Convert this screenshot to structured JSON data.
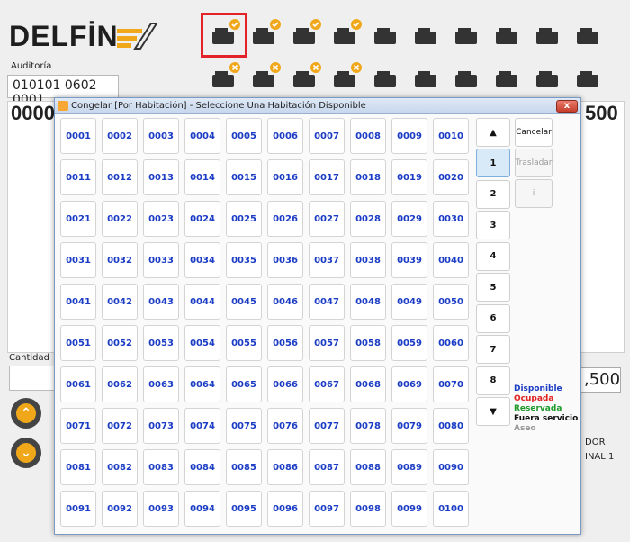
{
  "app": {
    "logo_text": "DELFİN",
    "auditoria_label": "Auditoría",
    "auditoria_value": "010101 0602 0001",
    "bg_left_number": "0000",
    "bg_right_number": "500",
    "cantidad_label": "Cantidad",
    "total_value": ",500",
    "side_text_1": "DOR",
    "side_text_2": "INAL 1",
    "accent_color": "#f0a81a",
    "highlight_color": "#e2232a"
  },
  "toolbar": {
    "row1_icons": [
      "bed-check-icon",
      "desk-person-check-icon",
      "person-money-check-icon",
      "person-check-icon",
      "percent-icon",
      "document-view-icon",
      "printer-icon",
      "card-add-icon",
      "card-money-icon",
      "user-refresh-icon"
    ],
    "row2_icons": [
      "bed-cancel-icon",
      "desk-person-cancel-icon",
      "person-money-cancel-icon",
      "person-cancel-icon",
      "trash-icon",
      "bottles-search-icon",
      "scale-icon",
      "credit-note-icon",
      "cash-icon",
      "more-icon"
    ]
  },
  "dialog": {
    "title": "Congelar [Por Habitación] - Seleccione Una Habitación Disponible",
    "close_label": "x",
    "rooms": [
      "0001",
      "0002",
      "0003",
      "0004",
      "0005",
      "0006",
      "0007",
      "0008",
      "0009",
      "0010",
      "0011",
      "0012",
      "0013",
      "0014",
      "0015",
      "0016",
      "0017",
      "0018",
      "0019",
      "0020",
      "0021",
      "0022",
      "0023",
      "0024",
      "0025",
      "0026",
      "0027",
      "0028",
      "0029",
      "0030",
      "0031",
      "0032",
      "0033",
      "0034",
      "0035",
      "0036",
      "0037",
      "0038",
      "0039",
      "0040",
      "0041",
      "0042",
      "0043",
      "0044",
      "0045",
      "0046",
      "0047",
      "0048",
      "0049",
      "0050",
      "0051",
      "0052",
      "0053",
      "0054",
      "0055",
      "0056",
      "0057",
      "0058",
      "0059",
      "0060",
      "0061",
      "0062",
      "0063",
      "0064",
      "0065",
      "0066",
      "0067",
      "0068",
      "0069",
      "0070",
      "0071",
      "0072",
      "0073",
      "0074",
      "0075",
      "0076",
      "0077",
      "0078",
      "0079",
      "0080",
      "0081",
      "0082",
      "0083",
      "0084",
      "0085",
      "0086",
      "0087",
      "0088",
      "0089",
      "0090",
      "0091",
      "0092",
      "0093",
      "0094",
      "0095",
      "0096",
      "0097",
      "0098",
      "0099",
      "0100"
    ],
    "page_up": "▲",
    "page_down": "▼",
    "pages": [
      "1",
      "2",
      "3",
      "4",
      "5",
      "6",
      "7",
      "8"
    ],
    "active_page": "1",
    "cancel_label": "Cancelar",
    "transfer_label": "Trasladar",
    "info_label": "i",
    "legend": [
      {
        "label": "Disponible",
        "color": "#1b3cc4"
      },
      {
        "label": "Ocupada",
        "color": "#e02020"
      },
      {
        "label": "Reservada",
        "color": "#1f9a2a"
      },
      {
        "label": "Fuera servicio",
        "color": "#111111"
      },
      {
        "label": "Aseo",
        "color": "#9a9a9a"
      }
    ]
  }
}
